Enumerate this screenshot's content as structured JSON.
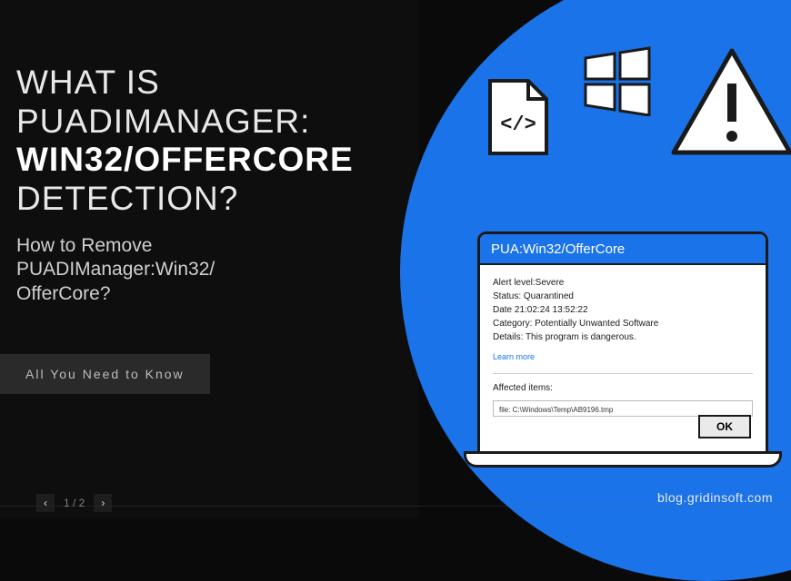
{
  "title": {
    "line1": "WHAT IS",
    "line2": "PUADIMANAGER:",
    "line3_bold": "WIN32/OFFERCORE",
    "line4": "DETECTION?"
  },
  "subtitle": {
    "line1": "How to Remove",
    "line2": "PUADIManager:Win32/",
    "line3": "OfferCore?"
  },
  "pill_label": "All You Need to Know",
  "dialog": {
    "titlebar": "PUA:Win32/OfferCore",
    "alert_level": "Alert level:Severe",
    "status": "Status: Quarantined",
    "date": "Date 21:02:24 13:52:22",
    "category": "Category: Potentially Unwanted Software",
    "details": "Details: This program is dangerous.",
    "learn_more": "Learn more",
    "affected_label": "Affected items:",
    "affected_file": "file: C:\\Windows\\Temp\\AB9196.tmp",
    "ok_label": "OK"
  },
  "site_url": "blog.gridinsoft.com",
  "paginator": {
    "prev": "‹",
    "count": "1 / 2",
    "next": "›"
  },
  "icons": {
    "file": "file-code-icon",
    "windows": "windows-icon",
    "warning": "warning-icon"
  }
}
